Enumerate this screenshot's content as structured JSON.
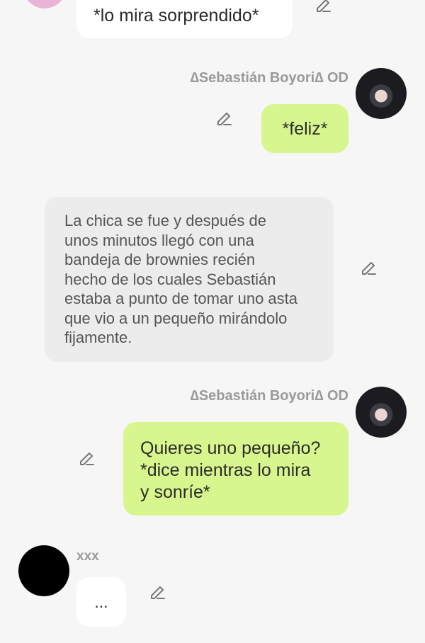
{
  "messages": [
    {
      "id": "m1",
      "side": "left",
      "text": "*lo mira sorprendido*"
    },
    {
      "id": "m2",
      "side": "right",
      "sender": "∆Sebastián Boyori∆ OD",
      "text": "*feliz*"
    },
    {
      "id": "m3",
      "type": "narration",
      "text": "La chica se fue y después de\nunos minutos llegó con una\nbandeja de brownies recién\nhecho de los cuales Sebastián\nestaba a punto de tomar uno asta\nque vio a un pequeño mirándolo\nfijamente."
    },
    {
      "id": "m4",
      "side": "right",
      "sender": "∆Sebastián Boyori∆ OD",
      "text": "Quieres uno pequeño?\n*dice mientras lo mira\ny sonríe*"
    },
    {
      "id": "m5",
      "side": "left",
      "sender": "xxx",
      "text": "..."
    }
  ],
  "icons": {
    "edit": "pencil-edit-icon"
  },
  "colors": {
    "background": "#f6f6f6",
    "user_bubble": "#d7f68d",
    "other_bubble": "#ffffff",
    "narration_bubble": "#ececec"
  }
}
